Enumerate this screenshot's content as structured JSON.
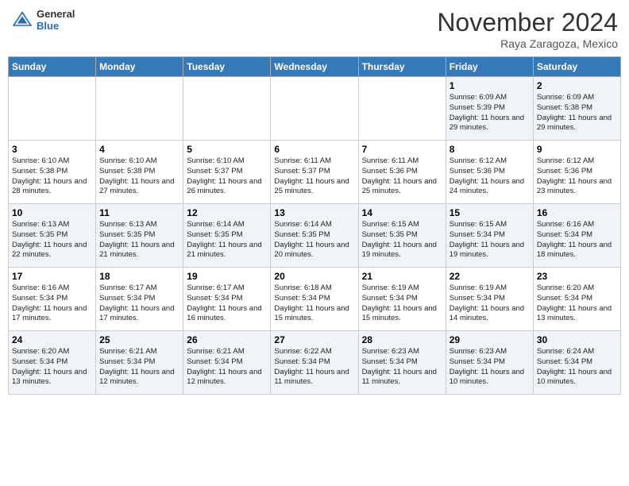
{
  "header": {
    "logo": {
      "line1": "General",
      "line2": "Blue"
    },
    "title": "November 2024",
    "location": "Raya Zaragoza, Mexico"
  },
  "weekdays": [
    "Sunday",
    "Monday",
    "Tuesday",
    "Wednesday",
    "Thursday",
    "Friday",
    "Saturday"
  ],
  "weeks": [
    [
      {
        "day": "",
        "info": ""
      },
      {
        "day": "",
        "info": ""
      },
      {
        "day": "",
        "info": ""
      },
      {
        "day": "",
        "info": ""
      },
      {
        "day": "",
        "info": ""
      },
      {
        "day": "1",
        "info": "Sunrise: 6:09 AM\nSunset: 5:39 PM\nDaylight: 11 hours and 29 minutes."
      },
      {
        "day": "2",
        "info": "Sunrise: 6:09 AM\nSunset: 5:38 PM\nDaylight: 11 hours and 29 minutes."
      }
    ],
    [
      {
        "day": "3",
        "info": "Sunrise: 6:10 AM\nSunset: 5:38 PM\nDaylight: 11 hours and 28 minutes."
      },
      {
        "day": "4",
        "info": "Sunrise: 6:10 AM\nSunset: 5:38 PM\nDaylight: 11 hours and 27 minutes."
      },
      {
        "day": "5",
        "info": "Sunrise: 6:10 AM\nSunset: 5:37 PM\nDaylight: 11 hours and 26 minutes."
      },
      {
        "day": "6",
        "info": "Sunrise: 6:11 AM\nSunset: 5:37 PM\nDaylight: 11 hours and 25 minutes."
      },
      {
        "day": "7",
        "info": "Sunrise: 6:11 AM\nSunset: 5:36 PM\nDaylight: 11 hours and 25 minutes."
      },
      {
        "day": "8",
        "info": "Sunrise: 6:12 AM\nSunset: 5:36 PM\nDaylight: 11 hours and 24 minutes."
      },
      {
        "day": "9",
        "info": "Sunrise: 6:12 AM\nSunset: 5:36 PM\nDaylight: 11 hours and 23 minutes."
      }
    ],
    [
      {
        "day": "10",
        "info": "Sunrise: 6:13 AM\nSunset: 5:35 PM\nDaylight: 11 hours and 22 minutes."
      },
      {
        "day": "11",
        "info": "Sunrise: 6:13 AM\nSunset: 5:35 PM\nDaylight: 11 hours and 21 minutes."
      },
      {
        "day": "12",
        "info": "Sunrise: 6:14 AM\nSunset: 5:35 PM\nDaylight: 11 hours and 21 minutes."
      },
      {
        "day": "13",
        "info": "Sunrise: 6:14 AM\nSunset: 5:35 PM\nDaylight: 11 hours and 20 minutes."
      },
      {
        "day": "14",
        "info": "Sunrise: 6:15 AM\nSunset: 5:35 PM\nDaylight: 11 hours and 19 minutes."
      },
      {
        "day": "15",
        "info": "Sunrise: 6:15 AM\nSunset: 5:34 PM\nDaylight: 11 hours and 19 minutes."
      },
      {
        "day": "16",
        "info": "Sunrise: 6:16 AM\nSunset: 5:34 PM\nDaylight: 11 hours and 18 minutes."
      }
    ],
    [
      {
        "day": "17",
        "info": "Sunrise: 6:16 AM\nSunset: 5:34 PM\nDaylight: 11 hours and 17 minutes."
      },
      {
        "day": "18",
        "info": "Sunrise: 6:17 AM\nSunset: 5:34 PM\nDaylight: 11 hours and 17 minutes."
      },
      {
        "day": "19",
        "info": "Sunrise: 6:17 AM\nSunset: 5:34 PM\nDaylight: 11 hours and 16 minutes."
      },
      {
        "day": "20",
        "info": "Sunrise: 6:18 AM\nSunset: 5:34 PM\nDaylight: 11 hours and 15 minutes."
      },
      {
        "day": "21",
        "info": "Sunrise: 6:19 AM\nSunset: 5:34 PM\nDaylight: 11 hours and 15 minutes."
      },
      {
        "day": "22",
        "info": "Sunrise: 6:19 AM\nSunset: 5:34 PM\nDaylight: 11 hours and 14 minutes."
      },
      {
        "day": "23",
        "info": "Sunrise: 6:20 AM\nSunset: 5:34 PM\nDaylight: 11 hours and 13 minutes."
      }
    ],
    [
      {
        "day": "24",
        "info": "Sunrise: 6:20 AM\nSunset: 5:34 PM\nDaylight: 11 hours and 13 minutes."
      },
      {
        "day": "25",
        "info": "Sunrise: 6:21 AM\nSunset: 5:34 PM\nDaylight: 11 hours and 12 minutes."
      },
      {
        "day": "26",
        "info": "Sunrise: 6:21 AM\nSunset: 5:34 PM\nDaylight: 11 hours and 12 minutes."
      },
      {
        "day": "27",
        "info": "Sunrise: 6:22 AM\nSunset: 5:34 PM\nDaylight: 11 hours and 11 minutes."
      },
      {
        "day": "28",
        "info": "Sunrise: 6:23 AM\nSunset: 5:34 PM\nDaylight: 11 hours and 11 minutes."
      },
      {
        "day": "29",
        "info": "Sunrise: 6:23 AM\nSunset: 5:34 PM\nDaylight: 11 hours and 10 minutes."
      },
      {
        "day": "30",
        "info": "Sunrise: 6:24 AM\nSunset: 5:34 PM\nDaylight: 11 hours and 10 minutes."
      }
    ]
  ]
}
